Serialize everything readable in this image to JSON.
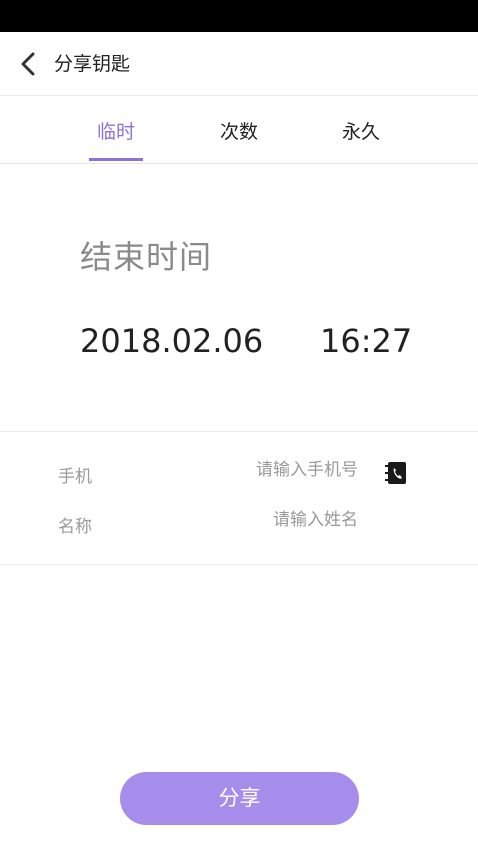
{
  "header": {
    "title": "分享钥匙"
  },
  "tabs": [
    {
      "label": "临时",
      "active": true
    },
    {
      "label": "次数",
      "active": false
    },
    {
      "label": "永久",
      "active": false
    }
  ],
  "end_time": {
    "label": "结束时间",
    "date": "2018.02.06",
    "time": "16:27"
  },
  "form": {
    "phone_label": "手机",
    "phone_placeholder": "请输入手机号",
    "name_label": "名称",
    "name_placeholder": "请输入姓名"
  },
  "actions": {
    "share_label": "分享"
  },
  "icons": {
    "back": "chevron-left-icon",
    "contacts": "contact-book-icon"
  },
  "colors": {
    "accent": "#8f72d9",
    "button": "#a68ceb",
    "status_bar": "#000000"
  }
}
